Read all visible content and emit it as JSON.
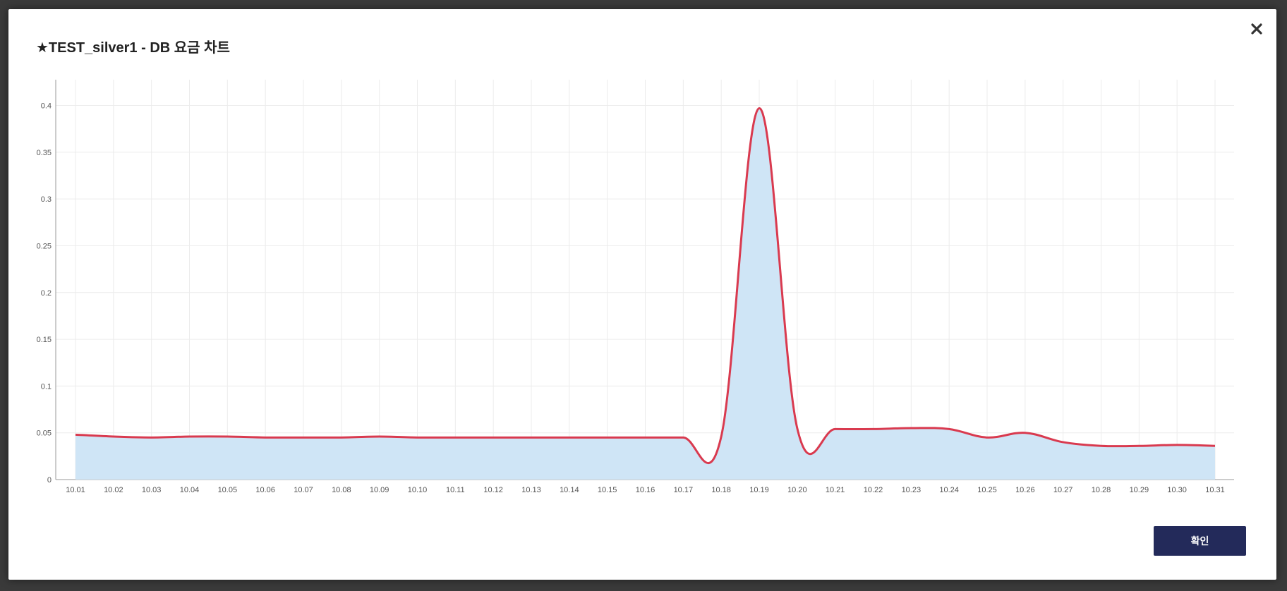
{
  "modal": {
    "title": "★TEST_silver1 - DB 요금 차트",
    "confirm_label": "확인",
    "close_icon": "close-icon"
  },
  "colors": {
    "line": "#d93a4f",
    "area": "#cfe5f6",
    "grid": "#ececec",
    "axis": "#999999",
    "button": "#232a5a"
  },
  "chart_data": {
    "type": "area",
    "title": "",
    "xlabel": "",
    "ylabel": "",
    "ylim": [
      0,
      0.42
    ],
    "yticks": [
      0,
      0.05,
      0.1,
      0.15,
      0.2,
      0.25,
      0.3,
      0.35,
      0.4
    ],
    "ytick_labels": [
      "0",
      "0.05",
      "0.1",
      "0.15",
      "0.2",
      "0.25",
      "0.3",
      "0.35",
      "0.4"
    ],
    "grid": true,
    "smooth": true,
    "categories": [
      "10.01",
      "10.02",
      "10.03",
      "10.04",
      "10.05",
      "10.06",
      "10.07",
      "10.08",
      "10.09",
      "10.10",
      "10.11",
      "10.12",
      "10.13",
      "10.14",
      "10.15",
      "10.16",
      "10.17",
      "10.18",
      "10.19",
      "10.20",
      "10.21",
      "10.22",
      "10.23",
      "10.24",
      "10.25",
      "10.26",
      "10.27",
      "10.28",
      "10.29",
      "10.30",
      "10.31"
    ],
    "series": [
      {
        "values": [
          0.048,
          0.046,
          0.045,
          0.046,
          0.046,
          0.045,
          0.045,
          0.045,
          0.046,
          0.045,
          0.045,
          0.045,
          0.045,
          0.045,
          0.045,
          0.045,
          0.045,
          0.046,
          0.397,
          0.055,
          0.054,
          0.054,
          0.055,
          0.054,
          0.045,
          0.05,
          0.04,
          0.036,
          0.036,
          0.037,
          0.036
        ]
      }
    ]
  }
}
